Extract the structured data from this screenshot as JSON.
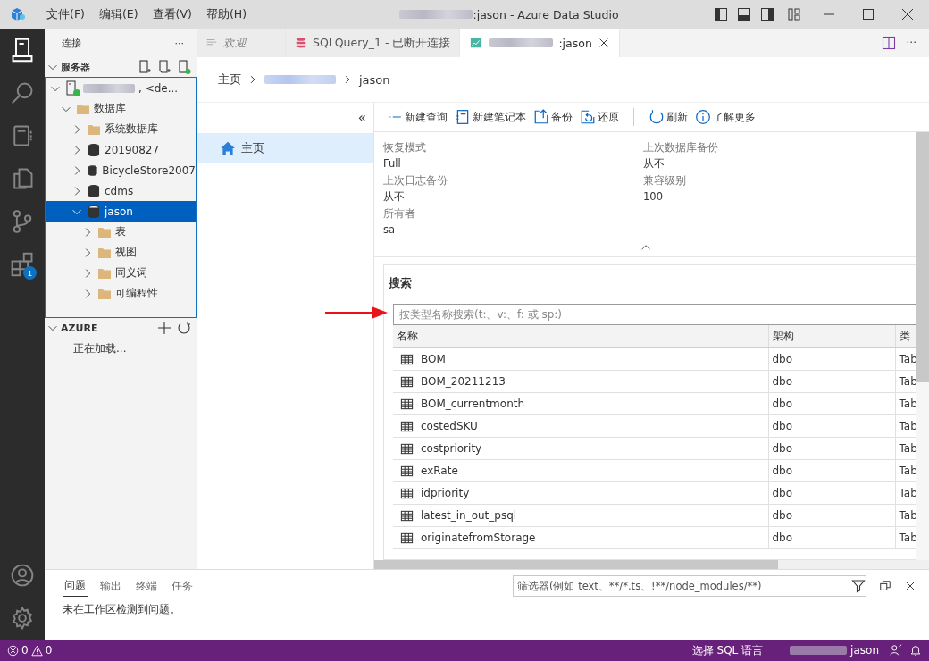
{
  "title_bar": {
    "menu": [
      "文件(F)",
      "编辑(E)",
      "查看(V)",
      "帮助(H)"
    ],
    "redacted": true,
    "title": ":jason - Azure Data Studio"
  },
  "activity_bar": {
    "items": [
      {
        "kind": "servers",
        "selected": true
      },
      {
        "kind": "search",
        "selected": false
      },
      {
        "kind": "notebook",
        "selected": false
      },
      {
        "kind": "explorer",
        "selected": false
      },
      {
        "kind": "source-control",
        "selected": false
      },
      {
        "kind": "extensions",
        "selected": false,
        "badge": "1"
      }
    ],
    "bottom": [
      {
        "kind": "account"
      },
      {
        "kind": "settings"
      }
    ]
  },
  "sidebar": {
    "title": "连接",
    "more": "···",
    "servers": {
      "title": "服务器",
      "expanded": true,
      "tree": [
        {
          "kind": "server",
          "label": ", <de...",
          "redacted": true,
          "expanded": true,
          "selected": false,
          "children": [
            {
              "kind": "folder",
              "label": "数据库",
              "expanded": true,
              "selected": false,
              "children": [
                {
                  "kind": "folder",
                  "label": "系统数据库",
                  "expanded": false,
                  "selected": false
                },
                {
                  "kind": "database",
                  "label": "20190827",
                  "expanded": false,
                  "selected": false
                },
                {
                  "kind": "database",
                  "label": "BicycleStore2007",
                  "expanded": false,
                  "selected": false
                },
                {
                  "kind": "database",
                  "label": "cdms",
                  "expanded": false,
                  "selected": false
                },
                {
                  "kind": "database",
                  "label": "jason",
                  "expanded": true,
                  "selected": true,
                  "children": [
                    {
                      "kind": "folder",
                      "label": "表",
                      "expanded": false,
                      "selected": false
                    },
                    {
                      "kind": "folder",
                      "label": "视图",
                      "expanded": false,
                      "selected": false
                    },
                    {
                      "kind": "folder",
                      "label": "同义词",
                      "expanded": false,
                      "selected": false
                    },
                    {
                      "kind": "folder",
                      "label": "可编程性",
                      "expanded": false,
                      "selected": false
                    }
                  ]
                }
              ]
            }
          ]
        }
      ]
    },
    "azure": {
      "title": "AZURE",
      "expanded": true,
      "message": "正在加载..."
    }
  },
  "editor_tabs": [
    {
      "kind": "welcome",
      "label": "欢迎",
      "selected": false
    },
    {
      "kind": "query",
      "label": "SQLQuery_1 - 已断开连接",
      "selected": false
    },
    {
      "kind": "dashboard",
      "label": ":jason",
      "redacted": true,
      "selected": true
    }
  ],
  "editor_more": "···",
  "breadcrumb": [
    {
      "kind": "text",
      "label": "主页"
    },
    {
      "kind": "redacted"
    },
    {
      "kind": "text",
      "label": "jason"
    }
  ],
  "nav": {
    "collapse": "«",
    "items": [
      {
        "label": "主页",
        "selected": true
      }
    ]
  },
  "toolbar": [
    {
      "kind": "new-query",
      "label": "新建查询"
    },
    {
      "kind": "new-notebook",
      "label": "新建笔记本"
    },
    {
      "kind": "backup",
      "label": "备份"
    },
    {
      "kind": "restore",
      "label": "还原"
    },
    {
      "kind": "separator"
    },
    {
      "kind": "refresh",
      "label": "刷新"
    },
    {
      "kind": "info",
      "label": "了解更多"
    }
  ],
  "properties": [
    {
      "label": "恢复模式",
      "value": "Full"
    },
    {
      "label": "上次数据库备份",
      "value": "从不"
    },
    {
      "label": "上次日志备份",
      "value": "从不"
    },
    {
      "label": "兼容级别",
      "value": "100"
    },
    {
      "label": "所有者",
      "value": "sa"
    }
  ],
  "search": {
    "title": "搜索",
    "placeholder": "按类型名称搜索(t:、v:、f: 或 sp:)",
    "columns": [
      "名称",
      "架构",
      "类"
    ],
    "rows": [
      [
        "BOM",
        "dbo",
        "Tab"
      ],
      [
        "BOM_20211213",
        "dbo",
        "Tab"
      ],
      [
        "BOM_currentmonth",
        "dbo",
        "Tab"
      ],
      [
        "costedSKU",
        "dbo",
        "Tab"
      ],
      [
        "costpriority",
        "dbo",
        "Tab"
      ],
      [
        "exRate",
        "dbo",
        "Tab"
      ],
      [
        "idpriority",
        "dbo",
        "Tab"
      ],
      [
        "latest_in_out_psql",
        "dbo",
        "Tab"
      ],
      [
        "originatefromStorage",
        "dbo",
        "Tab"
      ]
    ]
  },
  "panel": {
    "tabs": [
      {
        "label": "问题",
        "selected": true
      },
      {
        "label": "输出",
        "selected": false
      },
      {
        "label": "终端",
        "selected": false
      },
      {
        "label": "任务",
        "selected": false
      }
    ],
    "filter_placeholder": "筛选器(例如 text、**/*.ts、!**/node_modules/**)",
    "message": "未在工作区检测到问题。"
  },
  "status_bar": {
    "errors": "0",
    "warnings": "0",
    "language": "选择 SQL 语言",
    "connection": {
      "label": "jason",
      "redacted": true
    }
  }
}
